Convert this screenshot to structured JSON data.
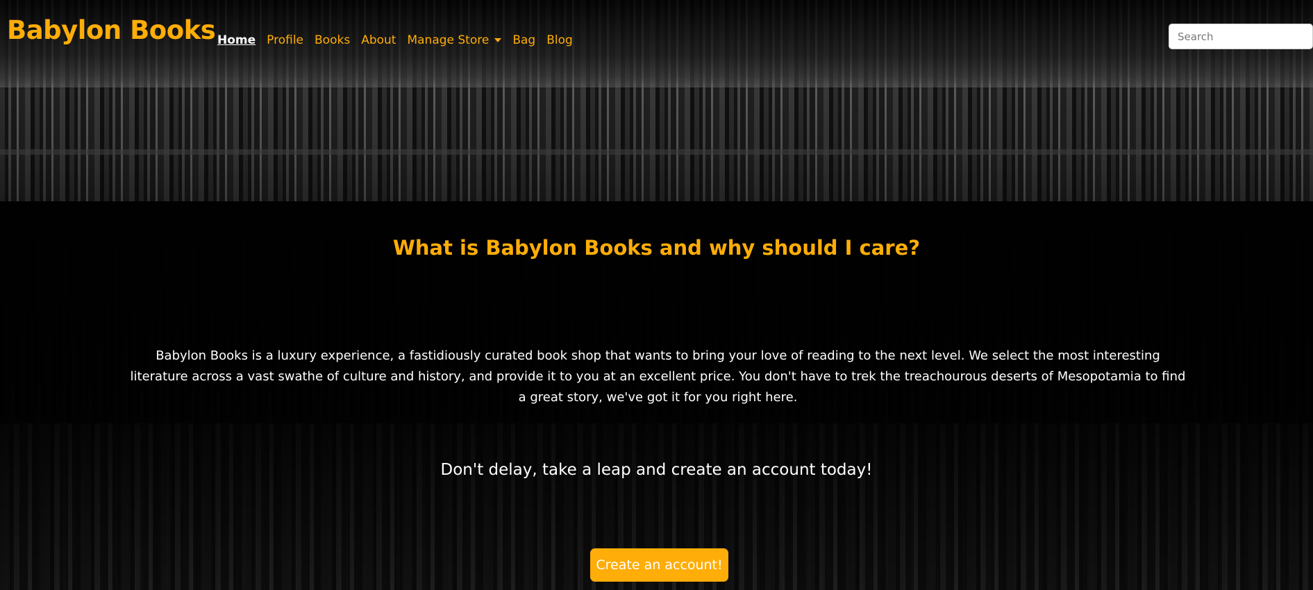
{
  "brand": "Babylon Books",
  "nav": {
    "home": "Home",
    "profile": "Profile",
    "books": "Books",
    "about": "About",
    "manage_store": "Manage Store",
    "bag": "Bag",
    "blog": "Blog"
  },
  "search": {
    "placeholder": "Search",
    "value": ""
  },
  "main": {
    "headline": "What is Babylon Books and why should I care?",
    "about_text": "Babylon Books is a luxury experience, a fastidiously curated book shop that wants to bring your love of reading to the next level. We select the most interesting literature across a vast swathe of culture and history, and provide it to you at an excellent price. You don't have to trek the treachourous deserts of Mesopotamia to find a great story, we've got it for you right here.",
    "cta_text": "Don't delay, take a leap and create an account today!",
    "cta_button": "Create an account!"
  },
  "colors": {
    "accent": "#ffad08",
    "text": "#ffffff",
    "background": "#000000"
  },
  "icons": {
    "dropdown": "caret-down-icon"
  }
}
